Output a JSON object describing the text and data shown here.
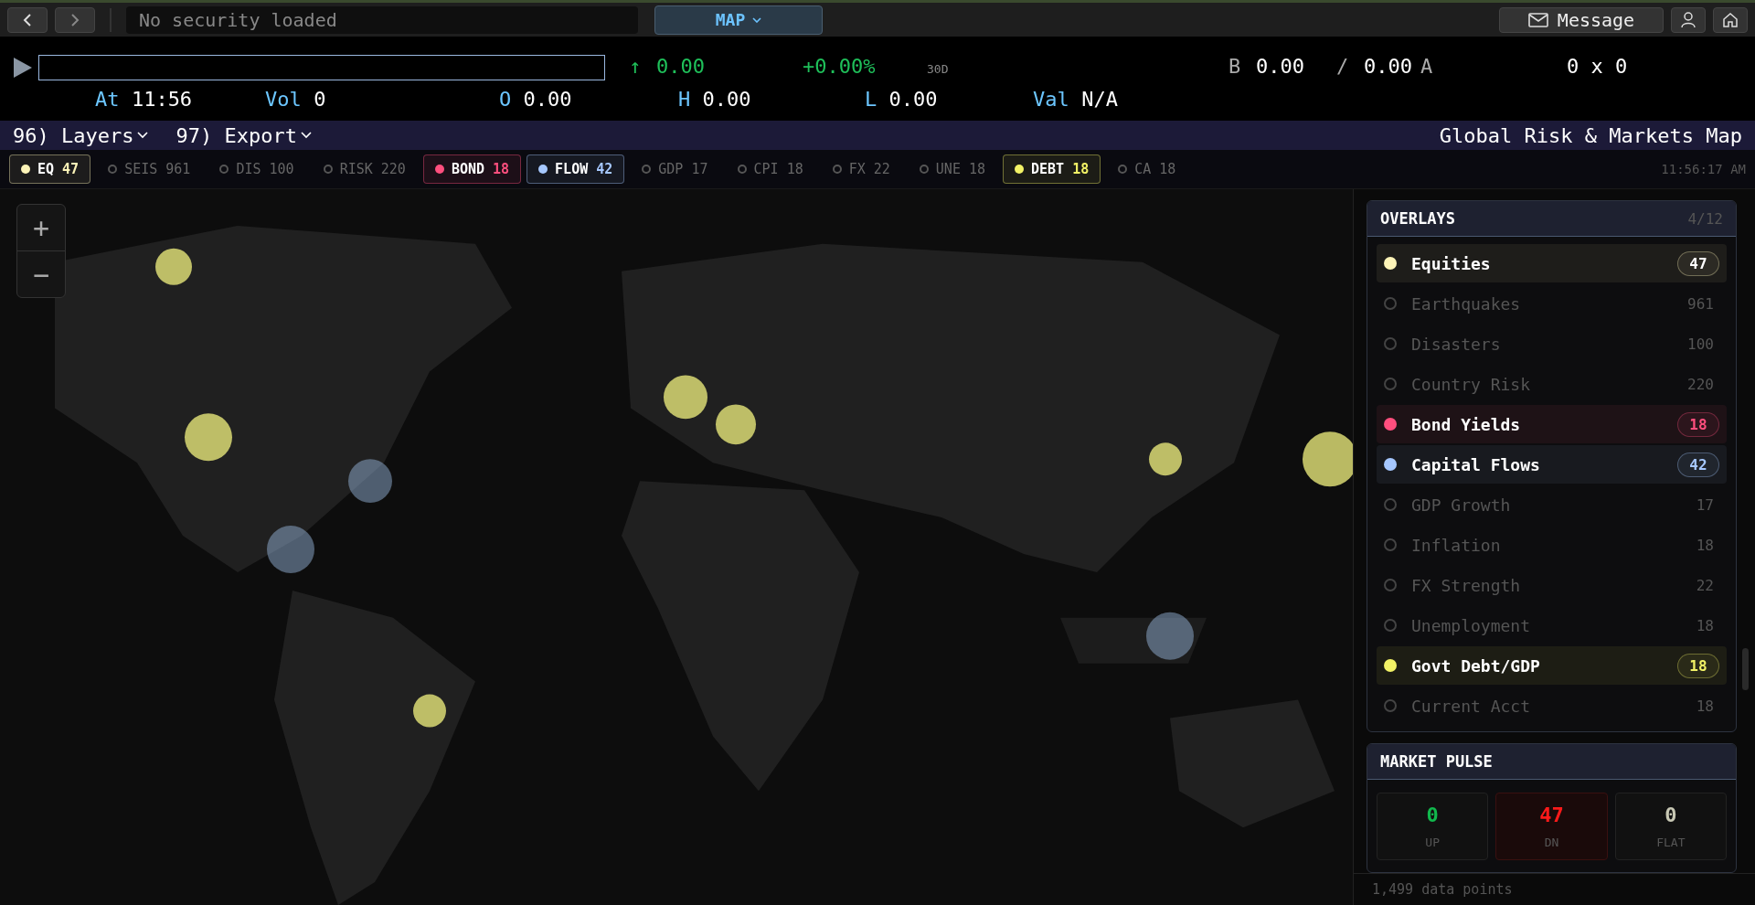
{
  "nav": {
    "security_placeholder": "No security loaded",
    "mode": "MAP",
    "message": "Message"
  },
  "quote": {
    "direction": "↑",
    "last": "0.00",
    "change": "+0.00%",
    "period": "30D",
    "bid_label": "B",
    "bid": "0.00",
    "separator": "/",
    "ask": "0.00",
    "ask_label": "A",
    "size": "0 x 0",
    "fields": [
      {
        "label": "At",
        "value": "11:56"
      },
      {
        "label": "Vol",
        "value": "0"
      },
      {
        "label": "O",
        "value": "0.00"
      },
      {
        "label": "H",
        "value": "0.00"
      },
      {
        "label": "L",
        "value": "0.00"
      },
      {
        "label": "Val",
        "value": "N/A"
      }
    ]
  },
  "menu": [
    {
      "number": "96)",
      "label": "Layers"
    },
    {
      "number": "97)",
      "label": "Export"
    }
  ],
  "title": "Global Risk & Markets Map",
  "chips": [
    {
      "code": "EQ",
      "count": "47",
      "on": true,
      "color": "#fdf4b8"
    },
    {
      "code": "SEIS",
      "count": "961",
      "on": false
    },
    {
      "code": "DIS",
      "count": "100",
      "on": false
    },
    {
      "code": "RISK",
      "count": "220",
      "on": false
    },
    {
      "code": "BOND",
      "count": "18",
      "on": true,
      "color": "#ff4f7e"
    },
    {
      "code": "FLOW",
      "count": "42",
      "on": true,
      "color": "#a6c8ff"
    },
    {
      "code": "GDP",
      "count": "17",
      "on": false
    },
    {
      "code": "CPI",
      "count": "18",
      "on": false
    },
    {
      "code": "FX",
      "count": "22",
      "on": false
    },
    {
      "code": "UNE",
      "count": "18",
      "on": false
    },
    {
      "code": "DEBT",
      "count": "18",
      "on": true,
      "color": "#f2f266"
    },
    {
      "code": "CA",
      "count": "18",
      "on": false
    }
  ],
  "clock": "11:56:17 AM",
  "map": {
    "kind": "picture",
    "zoom": [
      "+",
      "−"
    ]
  },
  "overlays": {
    "title": "OVERLAYS",
    "count": "4/12",
    "items": [
      {
        "label": "Equities",
        "count": "47",
        "on": true,
        "color": "#fdf4b8"
      },
      {
        "label": "Earthquakes",
        "count": "961",
        "on": false
      },
      {
        "label": "Disasters",
        "count": "100",
        "on": false
      },
      {
        "label": "Country Risk",
        "count": "220",
        "on": false
      },
      {
        "label": "Bond Yields",
        "count": "18",
        "on": true,
        "color": "#ff4f7e"
      },
      {
        "label": "Capital Flows",
        "count": "42",
        "on": true,
        "color": "#a6c8ff"
      },
      {
        "label": "GDP Growth",
        "count": "17",
        "on": false
      },
      {
        "label": "Inflation",
        "count": "18",
        "on": false
      },
      {
        "label": "FX Strength",
        "count": "22",
        "on": false
      },
      {
        "label": "Unemployment",
        "count": "18",
        "on": false
      },
      {
        "label": "Govt Debt/GDP",
        "count": "18",
        "on": true,
        "color": "#f2f266"
      },
      {
        "label": "Current Acct",
        "count": "18",
        "on": false
      }
    ]
  },
  "pulse": {
    "title": "MARKET PULSE",
    "stats": [
      {
        "kind": "up",
        "value": "0",
        "label": "UP"
      },
      {
        "kind": "down",
        "value": "47",
        "label": "DN"
      },
      {
        "kind": "flat",
        "value": "0",
        "label": "FLAT"
      }
    ]
  },
  "footer": "1,499 data points"
}
